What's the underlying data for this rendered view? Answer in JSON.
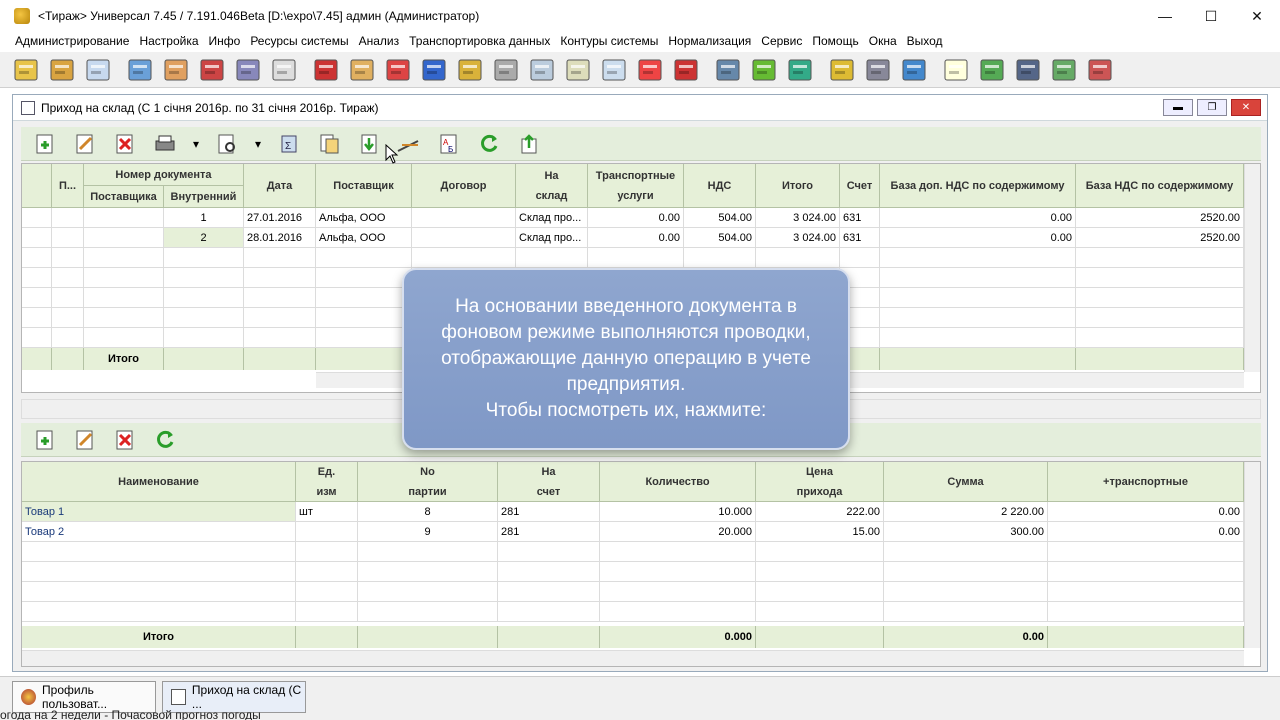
{
  "window": {
    "title": "<Тираж>  Универсал 7.45 /  7.191.046Beta   [D:\\expo\\7.45]   админ (Администратор)",
    "minimize": "—",
    "maximize": "☐",
    "close": "✕"
  },
  "menu": [
    "Администрирование",
    "Настройка",
    "Инфо",
    "Ресурсы системы",
    "Анализ",
    "Транспортировка данных",
    "Контуры системы",
    "Нормализация",
    "Сервис",
    "Помощь",
    "Окна",
    "Выход"
  ],
  "toolbar_icons": [
    "key-icon",
    "cash-icon",
    "book-icon",
    "abacus-icon",
    "catalog-icon",
    "sp-forms-build-icon",
    "folder-list-icon",
    "report-icon",
    "prices-icon",
    "pencil-icon",
    "dt-kt-icon",
    "transfer-631-icon",
    "coins-icon",
    "scales-icon",
    "spreadsheet-icon",
    "card-icon",
    "card2-icon",
    "invoice-icon",
    "prices2-icon",
    "books-icon",
    "olap-icon",
    "network-icon",
    "database-icon",
    "printer-icon",
    "exchange-icon",
    "note-icon",
    "grid-icon",
    "calculator-icon",
    "tools-icon",
    "settings-icon"
  ],
  "child": {
    "title": "Приход на склад (С 1 січня 2016р. по 31 січня 2016р. Тираж)"
  },
  "upper": {
    "headers": {
      "p": "П...",
      "docnum": "Номер документа",
      "supplier_no": "Поставщика",
      "internal_no": "Внутренний",
      "date": "Дата",
      "supplier": "Поставщик",
      "contract": "Договор",
      "to_warehouse": "На\nсклад",
      "transport": "Транспортные\nуслуги",
      "vat": "НДС",
      "total": "Итого",
      "account": "Счет",
      "base_add_vat": "База доп. НДС по содержимому",
      "base_vat": "База НДС по содержимому"
    },
    "rows": [
      {
        "internal": "1",
        "date": "27.01.2016",
        "supplier": "Альфа, ООО",
        "warehouse": "Склад про...",
        "transport": "0.00",
        "vat": "504.00",
        "total": "3 024.00",
        "account": "631",
        "base_add": "0.00",
        "base": "2520.00"
      },
      {
        "internal": "2",
        "date": "28.01.2016",
        "supplier": "Альфа, ООО",
        "warehouse": "Склад про...",
        "transport": "0.00",
        "vat": "504.00",
        "total": "3 024.00",
        "account": "631",
        "base_add": "0.00",
        "base": "2520.00"
      }
    ],
    "footer_label": "Итого"
  },
  "lower": {
    "headers": {
      "name": "Наименование",
      "unit": "Ед.\nизм",
      "batch": "No\nпартии",
      "account": "На\nсчет",
      "qty": "Количество",
      "price": "Цена\nприхода",
      "sum": "Сумма",
      "transport": "+транспортные"
    },
    "rows": [
      {
        "name": "Товар 1",
        "unit": "шт",
        "batch": "8",
        "account": "281",
        "qty": "10.000",
        "price": "222.00",
        "sum": "2 220.00",
        "transport": "0.00"
      },
      {
        "name": "Товар 2",
        "unit": "",
        "batch": "9",
        "account": "281",
        "qty": "20.000",
        "price": "15.00",
        "sum": "300.00",
        "transport": "0.00"
      }
    ],
    "footer": {
      "label": "Итого",
      "qty": "0.000",
      "sum": "0.00"
    }
  },
  "tooltip": {
    "text": "На основании введенного документа в фоновом режиме выполняются проводки, отображающие данную операцию в учете предприятия.\nЧтобы посмотреть их, нажмите:"
  },
  "taskbar": {
    "items": [
      "Профиль пользоват...",
      "Приход на склад (С ..."
    ],
    "status": "огода на 2 недели - Почасовой прогноз погоды"
  },
  "colors": {
    "header_bg": "#e6f0d8",
    "tooltip_bg": "#8fa6cf",
    "close_red": "#d9443b"
  }
}
